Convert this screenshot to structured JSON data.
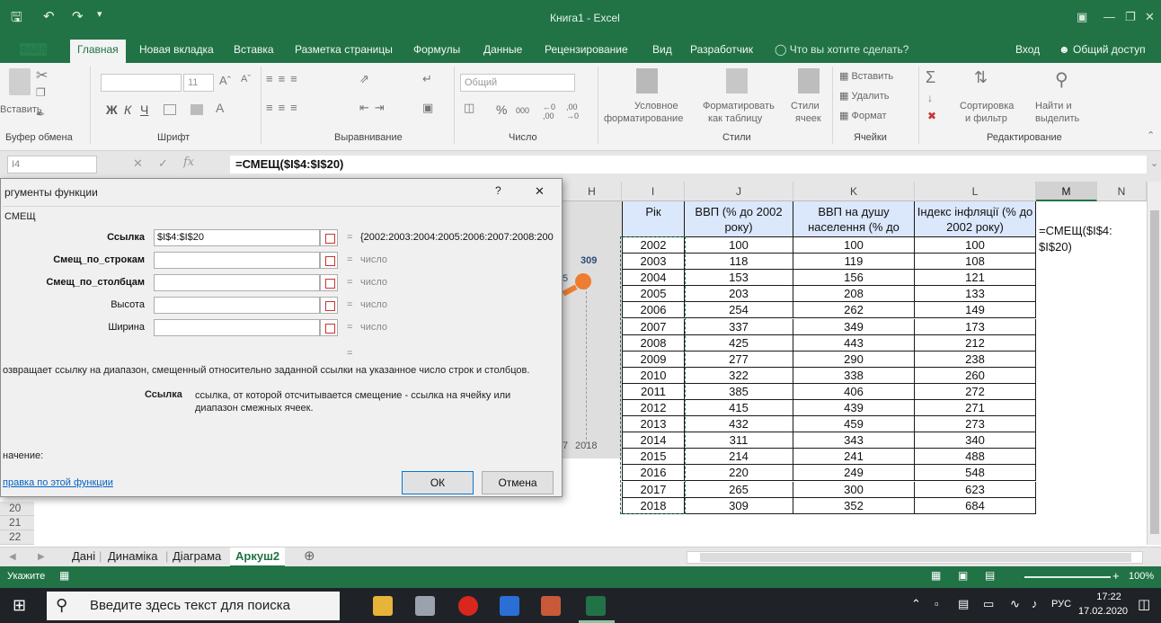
{
  "window": {
    "title": "Книга1 - Excel"
  },
  "ribbon_tabs": {
    "file": "Файл",
    "home": "Главная",
    "new_tab": "Новая вкладка",
    "insert": "Вставка",
    "layout": "Разметка страницы",
    "formulas": "Формулы",
    "data": "Данные",
    "review": "Рецензирование",
    "view": "Вид",
    "developer": "Разработчик",
    "tell_me": "Что вы хотите сделать?",
    "signin": "Вход",
    "share": "Общий доступ"
  },
  "ribbon": {
    "paste": "Вставить",
    "clipboard": "Буфер обмена",
    "font_size": "11",
    "bold": "Ж",
    "italic": "К",
    "underline": "Ч",
    "font_group": "Шрифт",
    "alignment_group": "Выравнивание",
    "number_format": "Общий",
    "number_group": "Число",
    "cond_format_1": "Условное",
    "cond_format_2": "форматирование",
    "format_table_1": "Форматировать",
    "format_table_2": "как таблицу",
    "styles_1": "Стили",
    "styles_2": "ячеек",
    "styles_group": "Стили",
    "cells_insert": "Вставить",
    "cells_delete": "Удалить",
    "cells_format": "Формат",
    "cells_group": "Ячейки",
    "sort_1": "Сортировка",
    "sort_2": "и фильтр",
    "find_1": "Найти и",
    "find_2": "выделить",
    "editing_group": "Редактирование"
  },
  "formula_bar": {
    "name_box": "I4",
    "fx": "fx",
    "formula": "=СМЕЩ($I$4:$I$20)"
  },
  "dialog": {
    "title": "ргументы функции",
    "func_name": "СМЕЩ",
    "args": [
      {
        "label": "Ссылка",
        "value": "$I$4:$I$20",
        "result": "{2002:2003:2004:2005:2006:2007:2008:200",
        "bold": false
      },
      {
        "label": "Смещ_по_строкам",
        "value": "",
        "result": "число",
        "bold": true
      },
      {
        "label": "Смещ_по_столбцам",
        "value": "",
        "result": "число",
        "bold": true
      },
      {
        "label": "Высота",
        "value": "",
        "result": "число",
        "bold": false
      },
      {
        "label": "Ширина",
        "value": "",
        "result": "число",
        "bold": false
      }
    ],
    "equals": "=",
    "description": "озвращает ссылку на диапазон, смещенный относительно заданной ссылки на указанное число строк и столбцов.",
    "arg_help_name": "Ссылка",
    "arg_help_text": "ссылка, от которой отсчитывается смещение - ссылка на ячейку или диапазон смежных ячеек.",
    "value_label": "начение:",
    "help_link": "правка по этой функции",
    "ok": "ОК",
    "cancel": "Отмена",
    "help_btn": "?",
    "close_btn": "✕"
  },
  "chart_fragments": {
    "label_309": "309",
    "label_5": "5",
    "axis_2018": "2018",
    "axis_7": "7"
  },
  "columns": {
    "h": "H",
    "i": "I",
    "j": "J",
    "k": "K",
    "l": "L",
    "m": "M",
    "n": "N"
  },
  "table": {
    "headers": [
      "Рік",
      "ВВП (% до 2002 року)",
      "ВВП на душу населення (% до",
      "Індекс інфляції (% до 2002 року)"
    ],
    "rows": [
      [
        "2002",
        "100",
        "100",
        "100"
      ],
      [
        "2003",
        "118",
        "119",
        "108"
      ],
      [
        "2004",
        "153",
        "156",
        "121"
      ],
      [
        "2005",
        "203",
        "208",
        "133"
      ],
      [
        "2006",
        "254",
        "262",
        "149"
      ],
      [
        "2007",
        "337",
        "349",
        "173"
      ],
      [
        "2008",
        "425",
        "443",
        "212"
      ],
      [
        "2009",
        "277",
        "290",
        "238"
      ],
      [
        "2010",
        "322",
        "338",
        "260"
      ],
      [
        "2011",
        "385",
        "406",
        "272"
      ],
      [
        "2012",
        "415",
        "439",
        "271"
      ],
      [
        "2013",
        "432",
        "459",
        "273"
      ],
      [
        "2014",
        "311",
        "343",
        "340"
      ],
      [
        "2015",
        "214",
        "241",
        "488"
      ],
      [
        "2016",
        "220",
        "249",
        "548"
      ],
      [
        "2017",
        "265",
        "300",
        "623"
      ],
      [
        "2018",
        "309",
        "352",
        "684"
      ]
    ],
    "m_cell_line1": "=СМЕЩ($I$4:",
    "m_cell_line2": "$I$20)"
  },
  "row_numbers": [
    "20",
    "21",
    "22"
  ],
  "sheets": [
    "Дані",
    "Динаміка",
    "Діаграма",
    "Аркуш2"
  ],
  "active_sheet": "Аркуш2",
  "status": {
    "mode": "Укажите",
    "zoom": "100%"
  },
  "taskbar": {
    "search_placeholder": "Введите здесь текст для поиска",
    "lang": "РУС",
    "time": "17:22",
    "date": "17.02.2020"
  },
  "colors": {
    "excel_green": "#217346",
    "header_fill": "#dbe7fb",
    "chart_orange": "#ed7d31"
  }
}
